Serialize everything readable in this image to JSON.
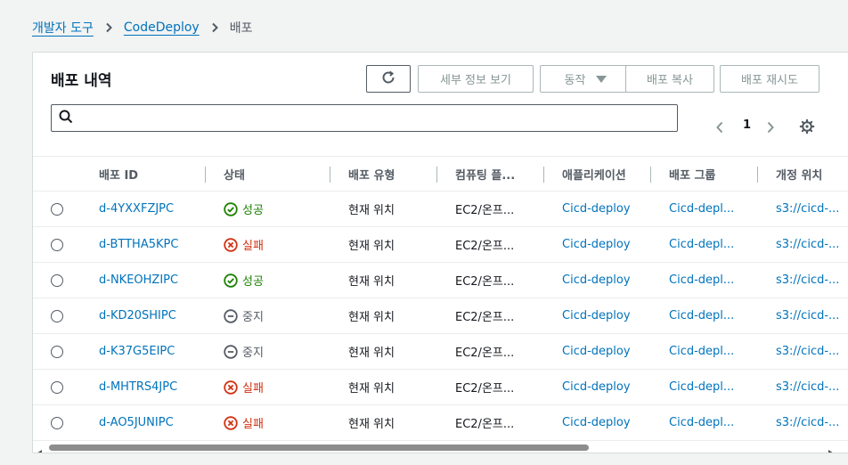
{
  "breadcrumb": {
    "items": [
      {
        "label": "개발자 도구"
      },
      {
        "label": "CodeDeploy"
      }
    ],
    "current": "배포"
  },
  "panel": {
    "title": "배포 내역",
    "buttons": {
      "details": "세부 정보 보기",
      "actions": "동작",
      "copy": "배포 복사",
      "retry": "배포 재시도"
    },
    "search": {
      "placeholder": "",
      "value": ""
    },
    "pagination": {
      "current_page": "1"
    }
  },
  "table": {
    "columns": [
      "배포 ID",
      "상태",
      "배포 유형",
      "컴퓨팅 플...",
      "애플리케이션",
      "배포 그룹",
      "개정 위치"
    ],
    "rows": [
      {
        "id": "d-4YXXFZJPC",
        "status": "성공",
        "status_type": "success",
        "type": "현재 위치",
        "platform": "EC2/온프...",
        "app": "Cicd-deploy",
        "group": "Cicd-depl...",
        "revision": "s3://cicd-..."
      },
      {
        "id": "d-BTTHA5KPC",
        "status": "실패",
        "status_type": "failed",
        "type": "현재 위치",
        "platform": "EC2/온프...",
        "app": "Cicd-deploy",
        "group": "Cicd-depl...",
        "revision": "s3://cicd-..."
      },
      {
        "id": "d-NKEOHZIPC",
        "status": "성공",
        "status_type": "success",
        "type": "현재 위치",
        "platform": "EC2/온프...",
        "app": "Cicd-deploy",
        "group": "Cicd-depl...",
        "revision": "s3://cicd-..."
      },
      {
        "id": "d-KD20SHIPC",
        "status": "중지",
        "status_type": "stopped",
        "type": "현재 위치",
        "platform": "EC2/온프...",
        "app": "Cicd-deploy",
        "group": "Cicd-depl...",
        "revision": "s3://cicd-..."
      },
      {
        "id": "d-K37G5EIPC",
        "status": "중지",
        "status_type": "stopped",
        "type": "현재 위치",
        "platform": "EC2/온프...",
        "app": "Cicd-deploy",
        "group": "Cicd-depl...",
        "revision": "s3://cicd-..."
      },
      {
        "id": "d-MHTRS4JPC",
        "status": "실패",
        "status_type": "failed",
        "type": "현재 위치",
        "platform": "EC2/온프...",
        "app": "Cicd-deploy",
        "group": "Cicd-depl...",
        "revision": "s3://cicd-..."
      },
      {
        "id": "d-AO5JUNIPC",
        "status": "실패",
        "status_type": "failed",
        "type": "현재 위치",
        "platform": "EC2/온프...",
        "app": "Cicd-deploy",
        "group": "Cicd-depl...",
        "revision": "s3://cicd-..."
      }
    ]
  },
  "colors": {
    "link": "#0073bb",
    "success": "#1d8102",
    "failed": "#d13212",
    "stopped": "#545b64"
  },
  "icons": {
    "refresh": "refresh-icon",
    "search": "search-icon",
    "prev": "chevron-left-icon",
    "next": "chevron-right-icon",
    "settings": "gear-icon",
    "success": "check-circle-icon",
    "failed": "x-circle-icon",
    "stopped": "minus-circle-icon"
  }
}
